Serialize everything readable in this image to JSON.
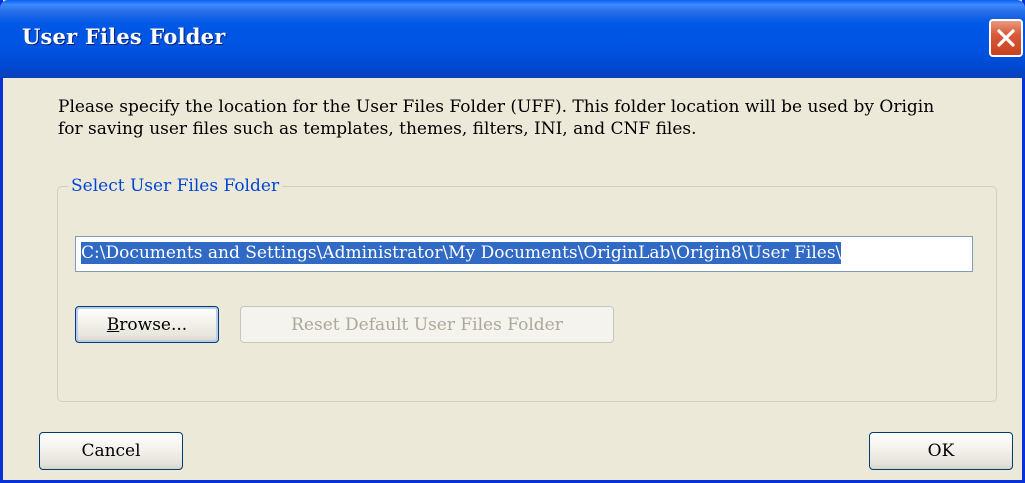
{
  "window": {
    "title": "User Files Folder",
    "close_icon": "close-icon"
  },
  "description": {
    "line1": "Please specify the location for the User Files Folder (UFF). This folder location will be used by Origin",
    "line2": "for saving user files such as templates, themes, filters, INI, and CNF files."
  },
  "group": {
    "legend": "Select User Files Folder",
    "path_value": "C:\\Documents and Settings\\Administrator\\My Documents\\OriginLab\\Origin8\\User Files\\",
    "browse_mnemonic": "B",
    "browse_rest": "rowse...",
    "reset_label": "Reset Default User Files Folder",
    "reset_enabled": false
  },
  "footer": {
    "cancel_label": "Cancel",
    "ok_label": "OK"
  },
  "colors": {
    "title_bar": "#0054e3",
    "legend_text": "#0046d5",
    "selection": "#316ac5",
    "close_button": "#d9593a"
  }
}
